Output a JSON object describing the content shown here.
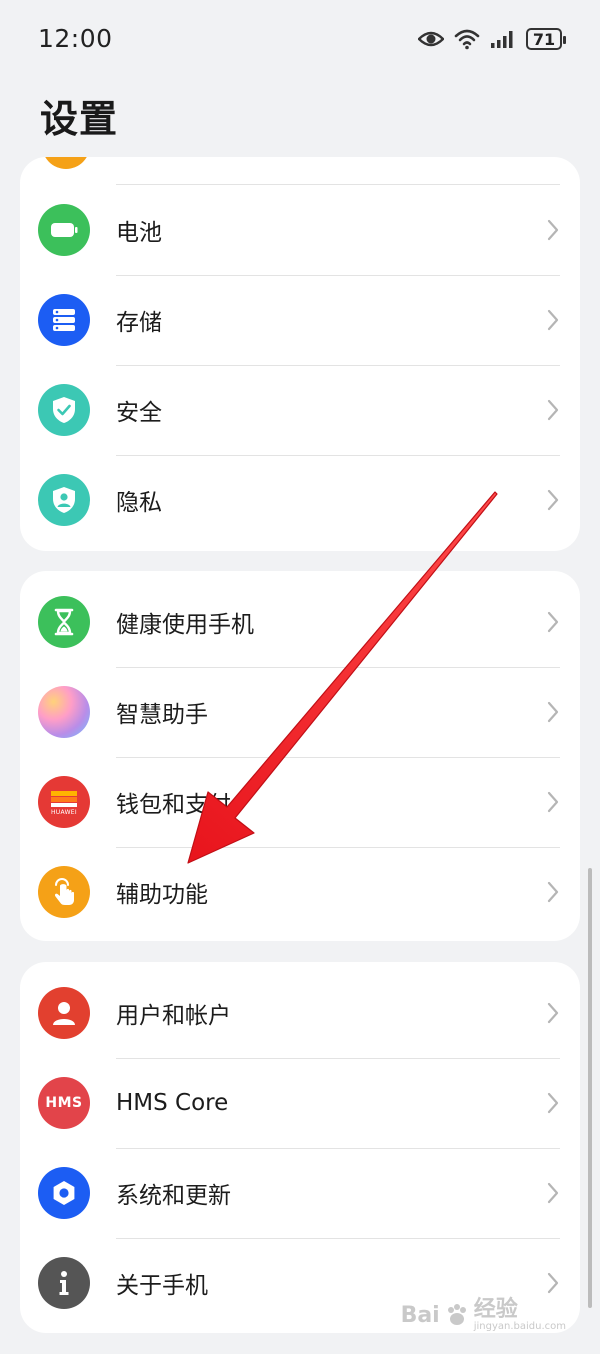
{
  "status_bar": {
    "time": "12:00",
    "battery": "71"
  },
  "page_title": "设置",
  "group1": {
    "items": [
      {
        "label": "电池",
        "icon": "battery-icon",
        "color": "#3cc05b"
      },
      {
        "label": "存储",
        "icon": "storage-icon",
        "color": "#1c5df3"
      },
      {
        "label": "安全",
        "icon": "shield-check-icon",
        "color": "#3cc8b4"
      },
      {
        "label": "隐私",
        "icon": "privacy-shield-icon",
        "color": "#3cc8b4"
      }
    ]
  },
  "group2": {
    "items": [
      {
        "label": "健康使用手机",
        "icon": "hourglass-icon",
        "color": "#3cc05b"
      },
      {
        "label": "智慧助手",
        "icon": "assistant-icon",
        "color": "#b98de8"
      },
      {
        "label": "钱包和支付",
        "icon": "wallet-icon",
        "icon_text": "HUAWEI",
        "color": "#e53935"
      },
      {
        "label": "辅助功能",
        "icon": "hand-tap-icon",
        "color": "#f5a117"
      }
    ]
  },
  "group3": {
    "items": [
      {
        "label": "用户和帐户",
        "icon": "user-icon",
        "color": "#e2402f"
      },
      {
        "label": "HMS Core",
        "icon": "hms-icon",
        "icon_text": "HMS",
        "color": "#e2444a"
      },
      {
        "label": "系统和更新",
        "icon": "gear-icon",
        "color": "#1c5df3"
      },
      {
        "label": "关于手机",
        "icon": "info-icon",
        "color": "#555555"
      }
    ]
  },
  "annotation": {
    "arrow_color": "#e8141c"
  },
  "watermark": {
    "logo": "Bai",
    "text": "经验",
    "sub": "jingyan.baidu.com"
  }
}
